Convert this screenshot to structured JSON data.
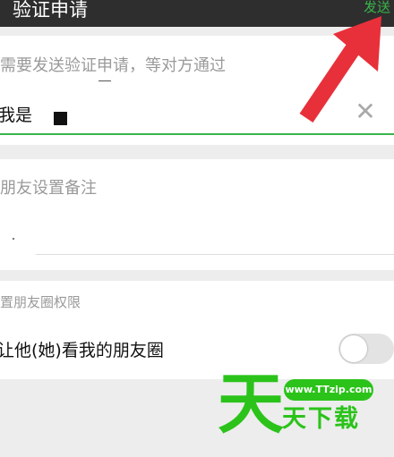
{
  "header": {
    "title": "验证申请",
    "send_label": "发送"
  },
  "request_section": {
    "hint": "需要发送验证申请，等对方通过",
    "input_value": "我是",
    "clear_icon": "close-icon"
  },
  "remark_section": {
    "hint": "朋友设置备注"
  },
  "moments_section": {
    "hint": "置朋友圈权限",
    "toggle_label": "让他(她)看我的朋友圈",
    "toggle_on": false
  },
  "watermark": {
    "big_char": "天",
    "url": "www.TTzip.com",
    "small_text": "天下载"
  },
  "colors": {
    "accent": "#39b54a",
    "topbar": "#2e2e2e",
    "arrow": "#e8303a",
    "watermark": "#2bc31a"
  }
}
